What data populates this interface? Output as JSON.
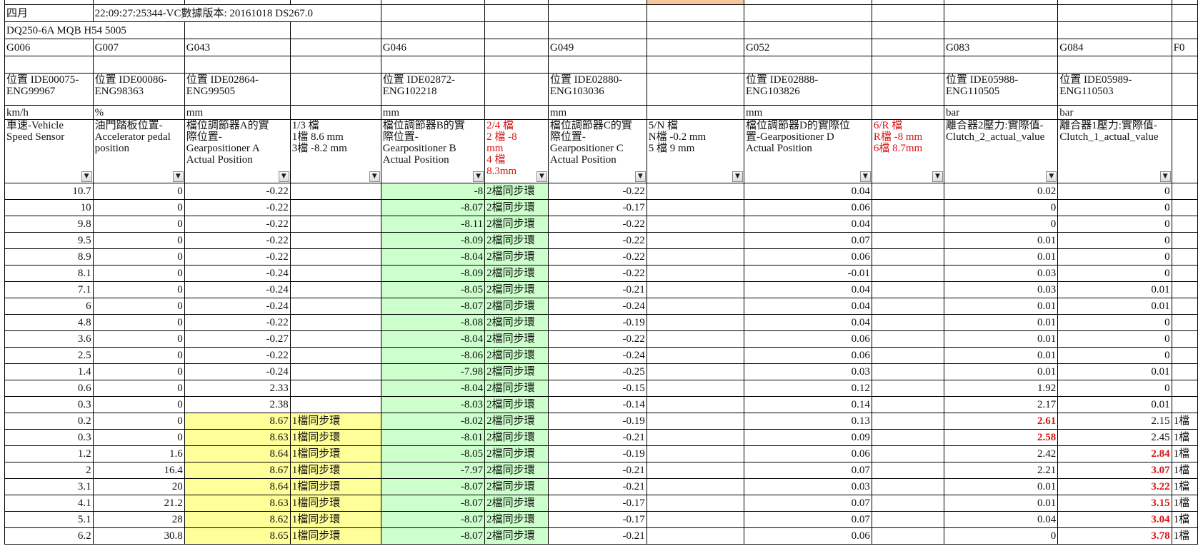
{
  "colors": {
    "green_fill": "#ccffcc",
    "yellow_fill": "#ffff99",
    "highlight_red": "#d91414",
    "active_column_header": "#f5c79b"
  },
  "meta": {
    "month": "四月",
    "timestamp": "22:09:27:25344-VC",
    "data_version": "數據版本: 20161018 DS267.0",
    "model": "DQ250-6A MQB  H54 5005"
  },
  "groups": [
    "G006",
    "G007",
    "G043",
    "",
    "G046",
    "",
    "G049",
    "",
    "G052",
    "",
    "G083",
    "G084",
    "F0"
  ],
  "ids": [
    "位置 IDE00075-ENG99967",
    "位置 IDE00086-ENG98363",
    "位置 IDE02864-ENG99505",
    "",
    "位置 IDE02872-ENG102218",
    "",
    "位置 IDE02880-ENG103036",
    "",
    "位置 IDE02888-ENG103826",
    "",
    "位置 IDE05988-ENG110505",
    "位置 IDE05989-ENG110503",
    ""
  ],
  "units": [
    "km/h",
    "%",
    "mm",
    "",
    "mm",
    "",
    "mm",
    "",
    "mm",
    "",
    "bar",
    "bar",
    ""
  ],
  "headers": [
    "車速-Vehicle Speed Sensor",
    "油門踏板位置-Accelerator pedal position",
    "檔位調節器A的實際位置-Gearpositioner A Actual Position",
    "1/3 檔\n1檔 8.6 mm\n3檔 -8.2 mm",
    "檔位調節器B的實際位置-Gearpositioner B Actual Position",
    "2/4 檔\n2 檔 -8 mm\n4 檔 8.3mm",
    "檔位調節器C的實際位置-Gearpositioner C Actual Position",
    "5/N 檔\nN檔 -0.2 mm\n5 檔 9 mm",
    "檔位調節器D的實際位置-Gearpositioner D Actual Position",
    "6/R 檔\nR檔 -8 mm\n6檔 8.7mm",
    "離合器2壓力:實際值-Clutch_2_actual_value",
    "離合器1壓力:實際值-Clutch_1_actual_value",
    ""
  ],
  "rows": [
    [
      "10.7",
      "0",
      "-0.22",
      "",
      "-8",
      "2檔同步環",
      "-0.22",
      "",
      "0.04",
      "",
      "0.02",
      "0",
      ""
    ],
    [
      "10",
      "0",
      "-0.22",
      "",
      "-8.07",
      "2檔同步環",
      "-0.17",
      "",
      "0.06",
      "",
      "0",
      "0",
      ""
    ],
    [
      "9.8",
      "0",
      "-0.22",
      "",
      "-8.11",
      "2檔同步環",
      "-0.22",
      "",
      "0.04",
      "",
      "0",
      "0",
      ""
    ],
    [
      "9.5",
      "0",
      "-0.22",
      "",
      "-8.09",
      "2檔同步環",
      "-0.22",
      "",
      "0.07",
      "",
      "0.01",
      "0",
      ""
    ],
    [
      "8.9",
      "0",
      "-0.22",
      "",
      "-8.04",
      "2檔同步環",
      "-0.22",
      "",
      "0.06",
      "",
      "0.01",
      "0",
      ""
    ],
    [
      "8.1",
      "0",
      "-0.24",
      "",
      "-8.09",
      "2檔同步環",
      "-0.22",
      "",
      "-0.01",
      "",
      "0.03",
      "0",
      ""
    ],
    [
      "7.1",
      "0",
      "-0.24",
      "",
      "-8.05",
      "2檔同步環",
      "-0.21",
      "",
      "0.04",
      "",
      "0.03",
      "0.01",
      ""
    ],
    [
      "6",
      "0",
      "-0.24",
      "",
      "-8.07",
      "2檔同步環",
      "-0.24",
      "",
      "0.04",
      "",
      "0.01",
      "0.01",
      ""
    ],
    [
      "4.8",
      "0",
      "-0.22",
      "",
      "-8.08",
      "2檔同步環",
      "-0.19",
      "",
      "0.04",
      "",
      "0.01",
      "0",
      ""
    ],
    [
      "3.6",
      "0",
      "-0.27",
      "",
      "-8.04",
      "2檔同步環",
      "-0.22",
      "",
      "0.06",
      "",
      "0.01",
      "0",
      ""
    ],
    [
      "2.5",
      "0",
      "-0.22",
      "",
      "-8.06",
      "2檔同步環",
      "-0.24",
      "",
      "0.06",
      "",
      "0.01",
      "0",
      ""
    ],
    [
      "1.4",
      "0",
      "-0.24",
      "",
      "-7.98",
      "2檔同步環",
      "-0.25",
      "",
      "0.03",
      "",
      "0.01",
      "0.01",
      ""
    ],
    [
      "0.6",
      "0",
      "2.33",
      "",
      "-8.04",
      "2檔同步環",
      "-0.15",
      "",
      "0.12",
      "",
      "1.92",
      "0",
      ""
    ],
    [
      "0.3",
      "0",
      "2.38",
      "",
      "-8.03",
      "2檔同步環",
      "-0.14",
      "",
      "0.14",
      "",
      "2.17",
      "0.01",
      ""
    ],
    [
      "0.2",
      "0",
      "8.67",
      "1檔同步環",
      "-8.02",
      "2檔同步環",
      "-0.19",
      "",
      "0.13",
      "",
      "2.61",
      "2.15",
      "1檔"
    ],
    [
      "0.3",
      "0",
      "8.63",
      "1檔同步環",
      "-8.01",
      "2檔同步環",
      "-0.21",
      "",
      "0.09",
      "",
      "2.58",
      "2.45",
      "1檔"
    ],
    [
      "1.2",
      "1.6",
      "8.64",
      "1檔同步環",
      "-8.05",
      "2檔同步環",
      "-0.19",
      "",
      "0.06",
      "",
      "2.42",
      "2.84",
      "1檔"
    ],
    [
      "2",
      "16.4",
      "8.67",
      "1檔同步環",
      "-7.97",
      "2檔同步環",
      "-0.21",
      "",
      "0.07",
      "",
      "2.21",
      "3.07",
      "1檔"
    ],
    [
      "3.1",
      "20",
      "8.64",
      "1檔同步環",
      "-8.07",
      "2檔同步環",
      "-0.21",
      "",
      "0.03",
      "",
      "0.01",
      "3.22",
      "1檔"
    ],
    [
      "4.1",
      "21.2",
      "8.63",
      "1檔同步環",
      "-8.07",
      "2檔同步環",
      "-0.17",
      "",
      "0.07",
      "",
      "0.01",
      "3.15",
      "1檔"
    ],
    [
      "5.1",
      "28",
      "8.62",
      "1檔同步環",
      "-8.07",
      "2檔同步環",
      "-0.17",
      "",
      "0.07",
      "",
      "0.04",
      "3.04",
      "1檔"
    ],
    [
      "6.2",
      "30.8",
      "8.65",
      "1檔同步環",
      "-8.07",
      "2檔同步環",
      "-0.21",
      "",
      "0.06",
      "",
      "0",
      "3.78",
      "1檔"
    ]
  ],
  "red_cells": [
    [
      14,
      10
    ],
    [
      15,
      10
    ],
    [
      16,
      11
    ],
    [
      17,
      11
    ],
    [
      18,
      11
    ],
    [
      19,
      11
    ],
    [
      20,
      11
    ],
    [
      21,
      11
    ]
  ]
}
